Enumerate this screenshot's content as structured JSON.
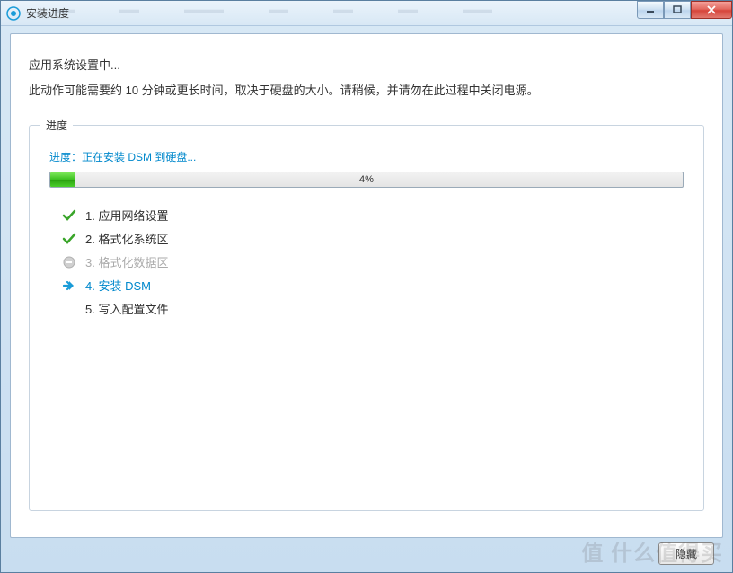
{
  "window": {
    "title": "安装进度"
  },
  "heading": "应用系统设置中...",
  "subheading": "此动作可能需要约 10 分钟或更长时间，取决于硬盘的大小。请稍候，并请勿在此过程中关闭电源。",
  "fieldset_legend": "进度",
  "progress": {
    "label": "进度：正在安装 DSM 到硬盘...",
    "percent_text": "4%",
    "percent_value": 4
  },
  "steps": [
    {
      "label": "1. 应用网络设置",
      "state": "done"
    },
    {
      "label": "2. 格式化系统区",
      "state": "done"
    },
    {
      "label": "3. 格式化数据区",
      "state": "skipped"
    },
    {
      "label": "4. 安装 DSM",
      "state": "current"
    },
    {
      "label": "5. 写入配置文件",
      "state": "pending"
    }
  ],
  "buttons": {
    "hide": "隐藏"
  },
  "watermark": "值 什么值得买"
}
